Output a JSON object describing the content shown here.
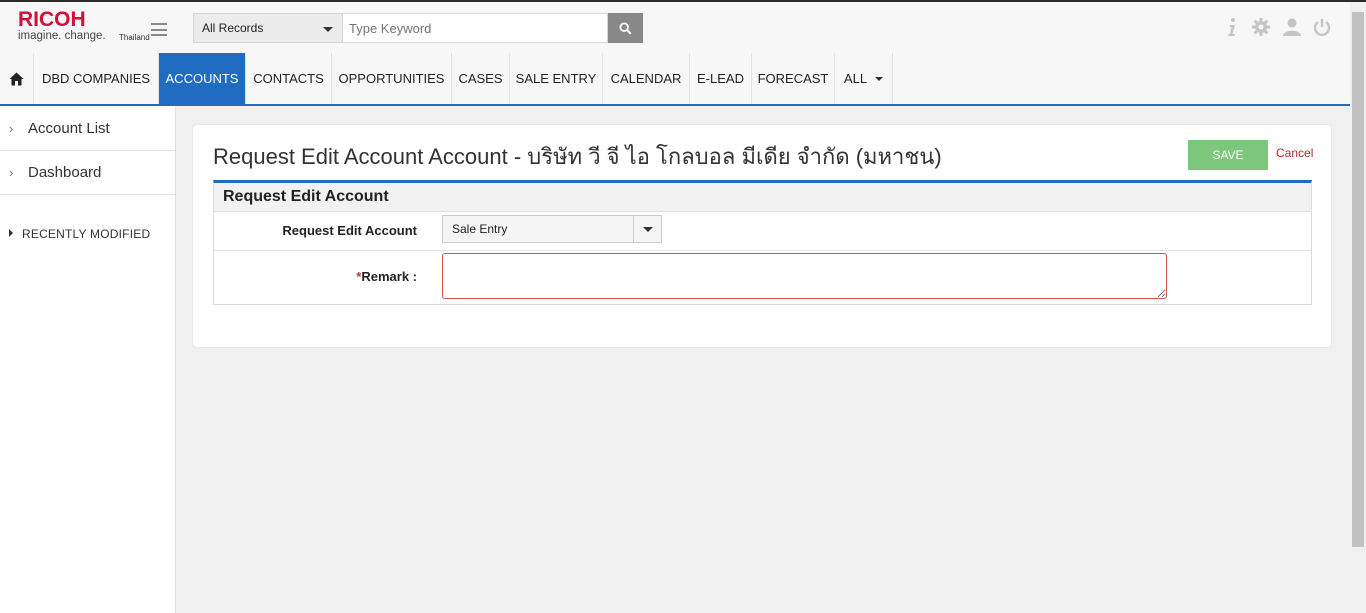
{
  "header": {
    "logo": {
      "brand": "RICOH",
      "tagline": "imagine. change.",
      "country": "Thailand"
    },
    "search": {
      "scope": "All Records",
      "placeholder": "Type Keyword"
    },
    "icons": [
      "info-icon",
      "gear-icon",
      "user-icon",
      "power-icon"
    ]
  },
  "nav": {
    "items": [
      {
        "label": "",
        "icon": "home-icon"
      },
      {
        "label": "DBD COMPANIES"
      },
      {
        "label": "ACCOUNTS",
        "active": true
      },
      {
        "label": "CONTACTS"
      },
      {
        "label": "OPPORTUNITIES"
      },
      {
        "label": "CASES"
      },
      {
        "label": "SALE ENTRY"
      },
      {
        "label": "CALENDAR"
      },
      {
        "label": "E-LEAD"
      },
      {
        "label": "FORECAST"
      },
      {
        "label": "ALL"
      }
    ]
  },
  "sidebar": {
    "items": [
      {
        "label": "Account List"
      },
      {
        "label": "Dashboard"
      }
    ],
    "recent_label": "RECENTLY MODIFIED"
  },
  "main": {
    "title": "Request Edit Account Account - บริษัท วี จี ไอ โกลบอล มีเดีย จำกัด (มหาชน)",
    "save_label": "SAVE",
    "cancel_label": "Cancel",
    "panel_title": "Request Edit Account",
    "fields": {
      "request_label": "Request Edit Account",
      "request_value": "Sale Entry",
      "remark_required_mark": "*",
      "remark_label": "Remark :",
      "remark_value": ""
    }
  },
  "colors": {
    "brand": "#d0103a",
    "accent": "#1f6cc1",
    "save": "#7dc77d",
    "cancel": "#b22a2a"
  }
}
